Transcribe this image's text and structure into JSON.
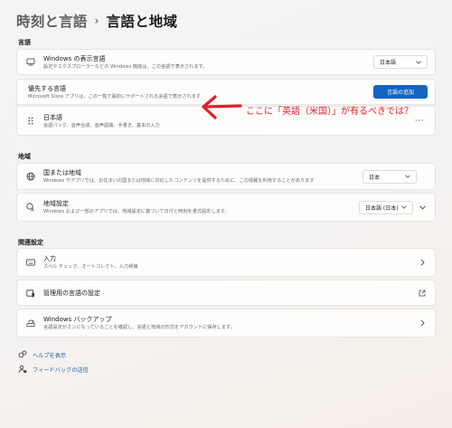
{
  "breadcrumb": {
    "parent": "時刻と言語",
    "separator": "›",
    "current": "言語と地域"
  },
  "language_section": {
    "label": "言語",
    "display_language": {
      "title": "Windows の表示言語",
      "subtitle": "設定やエクスプローラーなどの Windows 機能は、この言語で表示されます。",
      "value": "日本語"
    },
    "preferred": {
      "title": "優先する言語",
      "subtitle": "Microsoft Store アプリは、この一覧で最初にサポートされる言語で表示されます",
      "button": "言語の追加"
    },
    "japanese": {
      "title": "日本語",
      "subtitle": "言語パック、音声合成、音声認識、手書き、基本の入力",
      "more": "···"
    }
  },
  "annotation": {
    "text": "ここに「英語（米国）」が有るべきでは？",
    "color": "#e0202a"
  },
  "region_section": {
    "label": "地域",
    "country": {
      "title": "国または地域",
      "subtitle": "Windows やアプリでは、お住まいの国または地域に対応したコンテンツを提供するために、この情報を利用することがあります",
      "value": "日本"
    },
    "format": {
      "title": "地域設定",
      "subtitle": "Windows および一部のアプリでは、地域設定に基づいて日付と時刻を書式設定します。",
      "value": "日本語 (日本)"
    }
  },
  "related_section": {
    "label": "関連設定",
    "input": {
      "title": "入力",
      "subtitle": "スペル チェック、オートコレクト、入力候補"
    },
    "admin": {
      "title": "管理用の言語の設定"
    },
    "backup": {
      "title": "Windows バックアップ",
      "subtitle": "言語設定がオンになっていることを確認し、言語と地域の形式をアカウントに保存します。"
    }
  },
  "footer": {
    "help": "ヘルプを表示",
    "feedback": "フィードバックの送信"
  },
  "colors": {
    "accent": "#1464c0",
    "link": "#1f5ea8"
  }
}
